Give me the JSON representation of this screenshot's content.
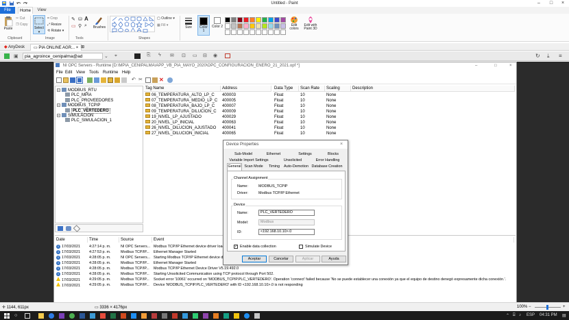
{
  "paint": {
    "title": "Untitled - Paint",
    "tabs": [
      "File",
      "Home",
      "View"
    ],
    "clipboard": {
      "paste": "Paste",
      "cut": "Cut",
      "copy": "Copy",
      "group": "Clipboard"
    },
    "image": {
      "select": "Select",
      "crop": "Crop",
      "resize": "Resize",
      "rotate": "Rotate",
      "group": "Image"
    },
    "tools": {
      "group": "Tools",
      "brushes": "Brushes"
    },
    "shapes": {
      "group": "Shapes",
      "outline": "Outline",
      "fill": "Fill"
    },
    "size": "Size",
    "color1": "Color 1",
    "color2": "Color 2",
    "edit_colors": "Edit colors",
    "edit_paint3d": "Edit with Paint 3D",
    "palette_row1": [
      "#000000",
      "#7f7f7f",
      "#880015",
      "#ed1c24",
      "#ff7f27",
      "#fff200",
      "#22b14c",
      "#00a2e8",
      "#3f48cc",
      "#a349a4"
    ],
    "palette_row2": [
      "#ffffff",
      "#c3c3c3",
      "#b97a57",
      "#ffaec9",
      "#ffc90e",
      "#efe4b0",
      "#b5e61d",
      "#99d9ea",
      "#7092be",
      "#c8bfe7"
    ],
    "status_cursor": "1144, 611px",
    "status_size": "3336 × 4176px",
    "zoom": "100%"
  },
  "anydesk": {
    "app": "AnyDesk",
    "tab": "PIA ONLINE AGR...",
    "address": "pia_agroince_cenipalma@ad"
  },
  "opc": {
    "title": "NI OPC Servers - Runtime [D:\\MPIA_CENIPALMA\\APP_VB_PIA_MAYO_2020\\OPC_CONFIGURACION_ENERO_21_2021.opf *]",
    "menu": [
      "File",
      "Edit",
      "View",
      "Tools",
      "Runtime",
      "Help"
    ],
    "tree": [
      {
        "label": "MODBUS_RTU",
        "level": 0,
        "type": "channel"
      },
      {
        "label": "PLC_MPIA",
        "level": 1,
        "type": "device"
      },
      {
        "label": "PLC_PROVEEDORES",
        "level": 1,
        "type": "device"
      },
      {
        "label": "MODBUS_TCPIP",
        "level": 0,
        "type": "channel"
      },
      {
        "label": "PLC_VERTEDERO",
        "level": 1,
        "type": "device",
        "selected": true
      },
      {
        "label": "SIMULACION",
        "level": 0,
        "type": "channel"
      },
      {
        "label": "PLC_SIMULACION_1",
        "level": 1,
        "type": "device"
      }
    ],
    "tag_columns": [
      "Tag Name",
      "Address",
      "Data Type",
      "Scan Rate",
      "Scaling",
      "Description"
    ],
    "tags": [
      [
        "06_TEMPERATURA_ALTO_LP_C",
        "400003",
        "Float",
        "10",
        "None",
        ""
      ],
      [
        "07_TEMPERATURA_MEDIO_LP_C",
        "400005",
        "Float",
        "10",
        "None",
        ""
      ],
      [
        "08_TEMPERATURA_BAJO_LP_C",
        "400007",
        "Float",
        "10",
        "None",
        ""
      ],
      [
        "09_TEMPERATURA_DILUCION_C",
        "400009",
        "Float",
        "10",
        "None",
        ""
      ],
      [
        "19_NIVEL_LP_AJUSTADO",
        "400029",
        "Float",
        "10",
        "None",
        ""
      ],
      [
        "20_NIVEL_LP_INICIAL",
        "400063",
        "Float",
        "10",
        "None",
        ""
      ],
      [
        "26_NIVEL_DILUCION_AJUSTADO",
        "400041",
        "Float",
        "10",
        "None",
        ""
      ],
      [
        "27_NIVEL_DILUCION_INICIAL",
        "400065",
        "Float",
        "10",
        "None",
        ""
      ]
    ],
    "event_columns": [
      "Date",
      "Time",
      "Source",
      "Event"
    ],
    "events": [
      {
        "level": "info",
        "date": "17/03/2021",
        "time": "4:27:14 p. m.",
        "source": "NI OPC Servers...",
        "event": "Modbus TCP/IP Ethernet device driver loaded"
      },
      {
        "level": "info",
        "date": "17/03/2021",
        "time": "4:27:53 p. m.",
        "source": "Modbus TCP/IP...",
        "event": "Ethernet Manager Started"
      },
      {
        "level": "info",
        "date": "17/03/2021",
        "time": "4:28:05 p. m.",
        "source": "NI OPC Servers...",
        "event": "Starting Modbus TCP/IP Ethernet device drive"
      },
      {
        "level": "info",
        "date": "17/03/2021",
        "time": "4:28:05 p. m.",
        "source": "Modbus TCP/IP...",
        "event": "Ethernet Manager Started"
      },
      {
        "level": "info",
        "date": "17/03/2021",
        "time": "4:28:05 p. m.",
        "source": "Modbus TCP/IP...",
        "event": "Modbus TCP/IP Ethernet Device Driver V5.19.492.0"
      },
      {
        "level": "info",
        "date": "17/03/2021",
        "time": "4:28:05 p. m.",
        "source": "Modbus TCP/IP...",
        "event": "Starting Unsolicited Communication using TCP protocol through Port 502."
      },
      {
        "level": "warn",
        "date": "17/03/2021",
        "time": "4:29:05 p. m.",
        "source": "Modbus TCP/IP...",
        "event": "Socket error '10061' occurred on 'MODBUS_TCPIP.PLC_VERTEDERO'. Operation 'connect' failed because 'No se puede establecer una conexión ya que el equipo de destino denegó expresamente dicha conexión.'."
      },
      {
        "level": "warn",
        "date": "17/03/2021",
        "time": "4:29:05 p. m.",
        "source": "Modbus TCP/IP...",
        "event": "Device 'MODBUS_TCPIP.PLC_VERTEDERO' with ID <192.168.10.10>.0 is not responding"
      }
    ]
  },
  "dialog": {
    "title": "Device Properties",
    "tabs_row1": [
      "Sub-Model",
      "Ethernet",
      "Settings",
      "Blocks"
    ],
    "tabs_row2": [
      "Variable Import Settings",
      "Unsolicited",
      "Error Handling"
    ],
    "tabs_row3": [
      "General",
      "Scan Mode",
      "Timing",
      "Auto-Demotion",
      "Database Creation"
    ],
    "channel_group": "Channel Assignment",
    "channel_name_label": "Name:",
    "channel_name": "MODBUS_TCPIP",
    "driver_label": "Driver:",
    "driver": "Modbus TCP/IP Ethernet",
    "device_group": "Device",
    "device_name_label": "Name:",
    "device_name": "PLC_VERTEDERO",
    "model_label": "Model:",
    "model": "Modbus",
    "id_label": "ID:",
    "id": "<192.168.10.10>.0",
    "enable_label": "Enable data collection",
    "simulate_label": "Simulate Device",
    "buttons": [
      "Aceptar",
      "Cancelar",
      "Aplicar",
      "Ayuda"
    ]
  },
  "taskbar": {
    "lang": "ESP",
    "time": "04:31 PM"
  }
}
